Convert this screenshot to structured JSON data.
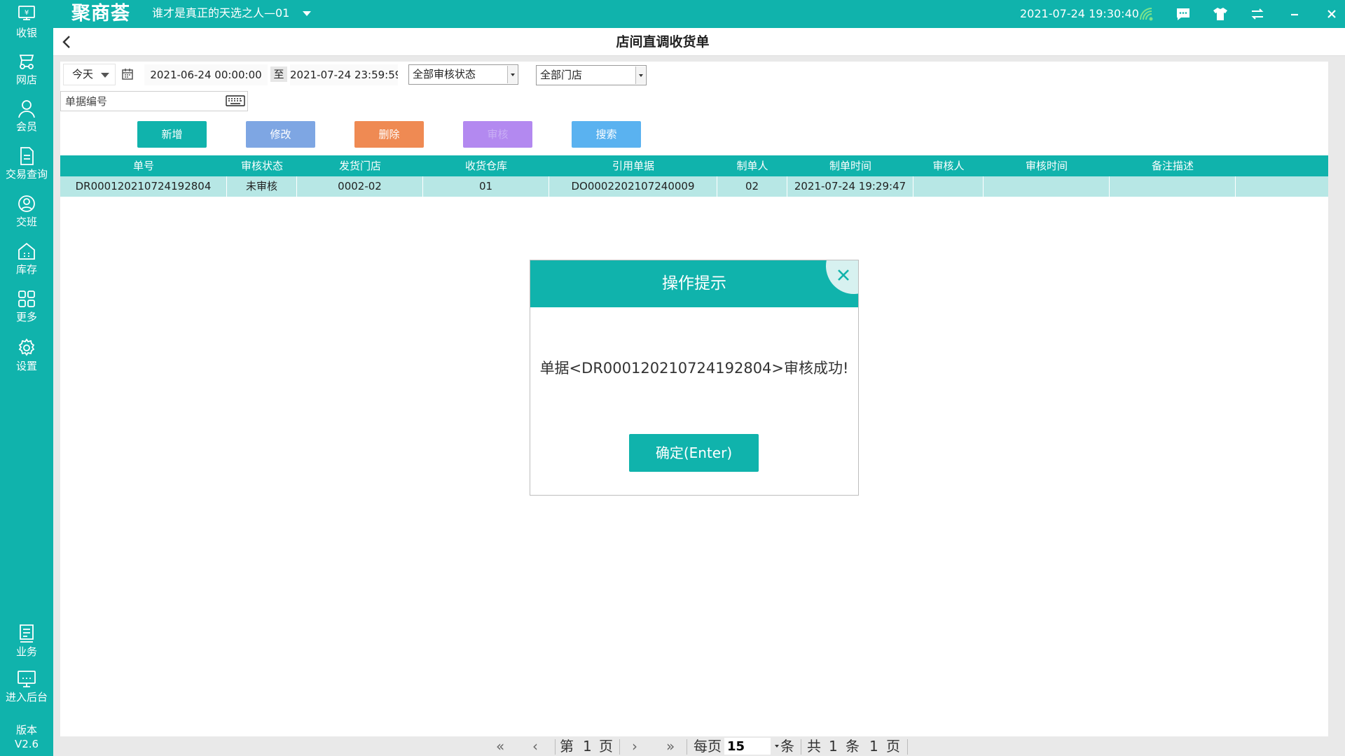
{
  "app": {
    "logo": "聚商荟",
    "shop_name": "谁才是真正的天选之人—01",
    "datetime": "2021-07-24 19:30:40",
    "version_label": "版本",
    "version": "V2.6"
  },
  "sidebar": {
    "items": [
      {
        "label": "收银",
        "icon": "cashier-icon"
      },
      {
        "label": "网店",
        "icon": "online-store-icon"
      },
      {
        "label": "会员",
        "icon": "member-icon"
      },
      {
        "label": "交易查询",
        "icon": "transaction-query-icon"
      },
      {
        "label": "交班",
        "icon": "shift-handover-icon"
      },
      {
        "label": "库存",
        "icon": "inventory-icon"
      },
      {
        "label": "更多",
        "icon": "more-grid-icon"
      },
      {
        "label": "设置",
        "icon": "settings-gear-icon"
      },
      {
        "label": "业务",
        "icon": "business-icon"
      },
      {
        "label": "进入后台",
        "icon": "backend-monitor-icon"
      }
    ]
  },
  "page": {
    "title": "店间直调收货单"
  },
  "filters": {
    "range": "今天",
    "date_from": "2021-06-24 00:00:00",
    "to_label": "至",
    "date_to": "2021-07-24 23:59:59",
    "audit_status": "全部审核状态",
    "store": "全部门店",
    "doc_no_placeholder": "单据编号"
  },
  "toolbar": {
    "add": "新增",
    "edit": "修改",
    "delete": "删除",
    "audit": "审核",
    "search": "搜索"
  },
  "table": {
    "columns": [
      "单号",
      "审核状态",
      "发货门店",
      "收货仓库",
      "引用单据",
      "制单人",
      "制单时间",
      "审核人",
      "审核时间",
      "备注描述"
    ],
    "rows": [
      [
        "DR000120210724192804",
        "未审核",
        "0002-02",
        "01",
        "DO0002202107240009",
        "02",
        "2021-07-24 19:29:47",
        "",
        "",
        ""
      ]
    ]
  },
  "pager": {
    "page_prefix": "第",
    "page": "1",
    "page_suffix": "页",
    "per_page_label": "每页",
    "per_page": "15",
    "per_page_unit": "条",
    "total_prefix": "共",
    "total_records": "1",
    "total_unit": "条",
    "total_pages": "1",
    "total_pages_unit": "页"
  },
  "dialog": {
    "title": "操作提示",
    "message": "单据<DR000120210724192804>审核成功!",
    "ok": "确定(Enter)"
  },
  "colors": {
    "brand": "#10b3ac",
    "add": "#10b3ac",
    "edit": "#7ea6e3",
    "delete": "#ef8a53",
    "audit": "#b389f0",
    "search": "#5ab2f0",
    "row_selected": "#b7e7e5"
  }
}
